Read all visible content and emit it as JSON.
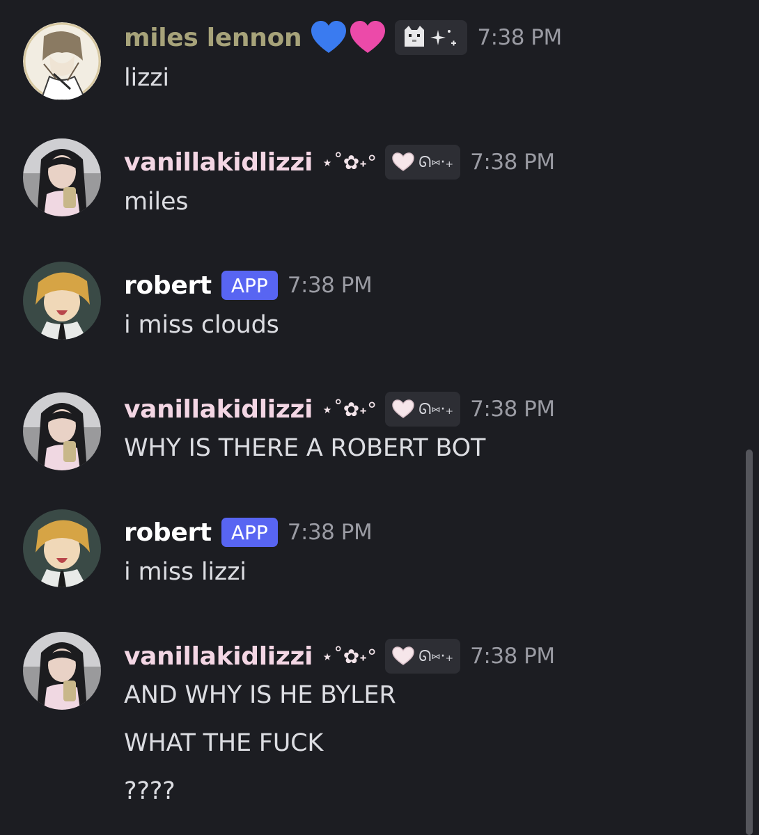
{
  "colors": {
    "background": "#1c1d22",
    "miles_name": "#a7a37a",
    "lizzi_name": "#f3d6e4",
    "robert_name": "#ffffff",
    "app_tag": "#5865f2",
    "timestamp": "#9a9ba3",
    "message_text": "#dcdde2"
  },
  "messages": [
    {
      "author": "miles lennon",
      "name_emojis": "💙💗",
      "badge_icons": [
        "cat-icon",
        "sparkle-icon"
      ],
      "time": "7:38 PM",
      "lines": [
        "lizzi"
      ]
    },
    {
      "author": "vanillakidlizzi",
      "name_deco": "⋆˚✿˖°",
      "badge_icons": [
        "heart-icon"
      ],
      "badge_text": "ᘏ⑅·₊",
      "time": "7:38 PM",
      "lines": [
        "miles"
      ]
    },
    {
      "author": "robert",
      "app_tag": "APP",
      "time": "7:38 PM",
      "lines": [
        "i miss clouds"
      ]
    },
    {
      "author": "vanillakidlizzi",
      "name_deco": "⋆˚✿˖°",
      "badge_icons": [
        "heart-icon"
      ],
      "badge_text": "ᘏ⑅·₊",
      "time": "7:38 PM",
      "lines": [
        "WHY IS THERE A ROBERT BOT"
      ]
    },
    {
      "author": "robert",
      "app_tag": "APP",
      "time": "7:38 PM",
      "lines": [
        "i miss lizzi"
      ]
    },
    {
      "author": "vanillakidlizzi",
      "name_deco": "⋆˚✿˖°",
      "badge_icons": [
        "heart-icon"
      ],
      "badge_text": "ᘏ⑅·₊",
      "time": "7:38 PM",
      "lines": [
        "AND WHY IS HE BYLER",
        "WHAT THE FUCK",
        "????"
      ]
    }
  ]
}
